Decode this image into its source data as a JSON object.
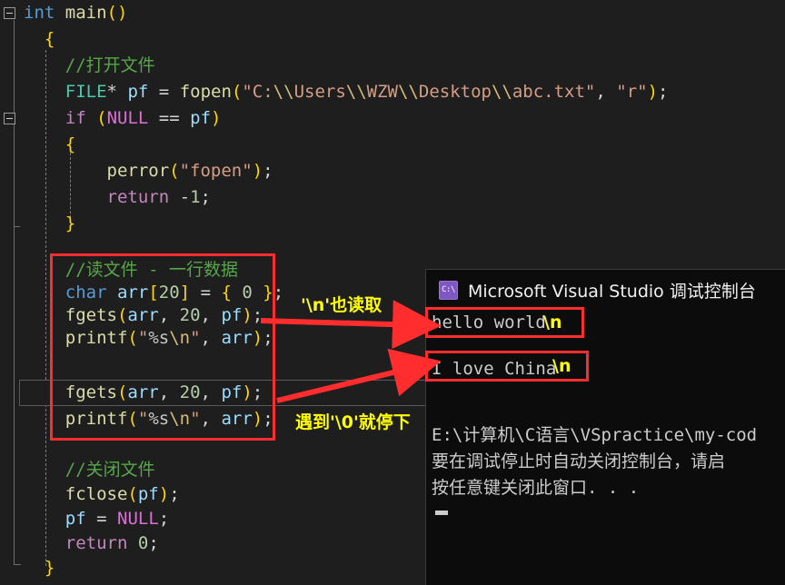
{
  "editor": {
    "background": "#1E1E1E",
    "lines": [
      "int main()",
      "{",
      "    //打开文件",
      "    FILE* pf = fopen(\"C:\\\\Users\\\\WZW\\\\Desktop\\\\abc.txt\", \"r\");",
      "    if (NULL == pf)",
      "    {",
      "        perror(\"fopen\");",
      "        return -1;",
      "    }",
      "",
      "    //读文件 - 一行数据",
      "    char arr[20] = { 0 };",
      "    fgets(arr, 20, pf);",
      "    printf(\"%s\\n\", arr);",
      "",
      "    fgets(arr, 20, pf);",
      "    printf(\"%s\\n\", arr);",
      "",
      "    //关闭文件",
      "    fclose(pf);",
      "    pf = NULL;",
      "    return 0;",
      "}"
    ],
    "tokens": {
      "int": "int",
      "main": "main",
      "paren_open": "(",
      "paren_close": ")",
      "brace_open": "{",
      "brace_close": "}",
      "comment_open_file": "//打开文件",
      "comment_read_file": "//读文件 - 一行数据",
      "comment_close_file": "//关闭文件",
      "FILE": "FILE",
      "star": "*",
      "pf": "pf",
      "equals": "=",
      "fopen": "fopen",
      "path_string": "\"C:\\\\Users\\\\WZW\\\\Desktop\\\\abc.txt\"",
      "mode_string": "\"r\"",
      "comma": ",",
      "semicolon": ";",
      "if": "if",
      "NULL": "NULL",
      "eqeq": "==",
      "perror": "perror",
      "fopen_string": "\"fopen\"",
      "return": "return",
      "minus_one": "-1",
      "char": "char",
      "arr": "arr",
      "bracket_20": "[20]",
      "zero": "0",
      "fgets": "fgets",
      "twenty": "20",
      "printf": "printf",
      "fmt_string": "\"%s\\n\"",
      "fclose": "fclose",
      "zero_ret": "0"
    },
    "colors": {
      "keyword": "#569CD6",
      "control": "#C586C0",
      "type": "#4EC9B0",
      "function": "#DCDCAA",
      "variable": "#9CDCFE",
      "number": "#B5CEA8",
      "string": "#D69D85",
      "escape": "#D7BA7D",
      "comment": "#57A64A",
      "punctuation": "#D4D4D4",
      "bracket1": "#FFD700",
      "bracket2": "#DA70D6"
    }
  },
  "annotations": {
    "color": "#FFFF00",
    "box_color": "#FF2D2D",
    "note_newline_read": "'\\n'也读取",
    "note_stop_at_null": "遇到'\\0'就停下",
    "tag_newline_1": "\\n",
    "tag_newline_2": "\\n"
  },
  "console": {
    "title": "Microsoft Visual Studio 调试控制台",
    "icon_label": "C:\\",
    "background": "#0C0C0C",
    "output_lines": [
      "hello world",
      "I love China"
    ],
    "status_lines": [
      "E:\\计算机\\C语言\\VSpractice\\my-cod",
      "要在调试停止时自动关闭控制台，请启",
      "按任意键关闭此窗口. . ."
    ]
  }
}
